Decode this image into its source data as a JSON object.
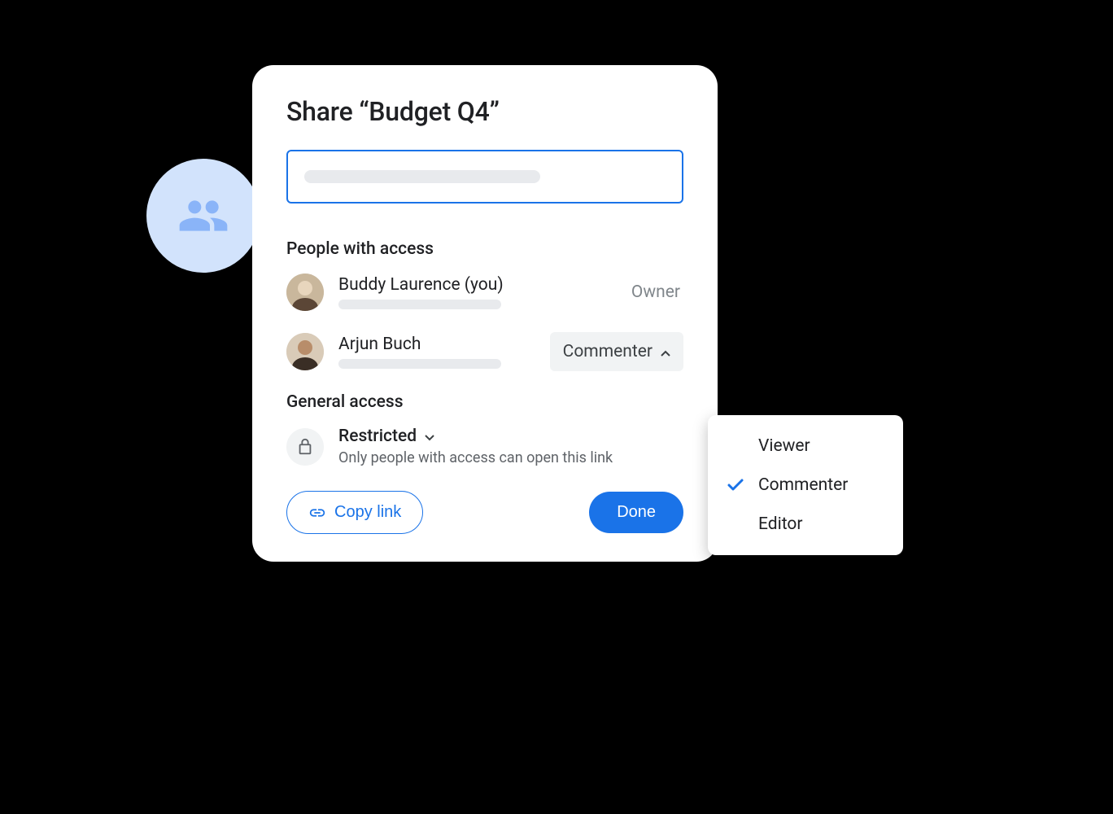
{
  "dialog": {
    "title": "Share “Budget Q4”",
    "people_heading": "People with access",
    "people": [
      {
        "name": "Buddy Laurence (you)",
        "role": "Owner"
      },
      {
        "name": "Arjun Buch",
        "role": "Commenter"
      }
    ],
    "general_heading": "General access",
    "general_title": "Restricted",
    "general_desc": "Only people with access can open this link",
    "copy_link_label": "Copy link",
    "done_label": "Done"
  },
  "role_menu": {
    "options": [
      "Viewer",
      "Commenter",
      "Editor"
    ],
    "selected": "Commenter"
  },
  "colors": {
    "primary": "#1a73e8",
    "circle_bg": "#d2e3fc",
    "circle_icon": "#8ab4f8"
  }
}
